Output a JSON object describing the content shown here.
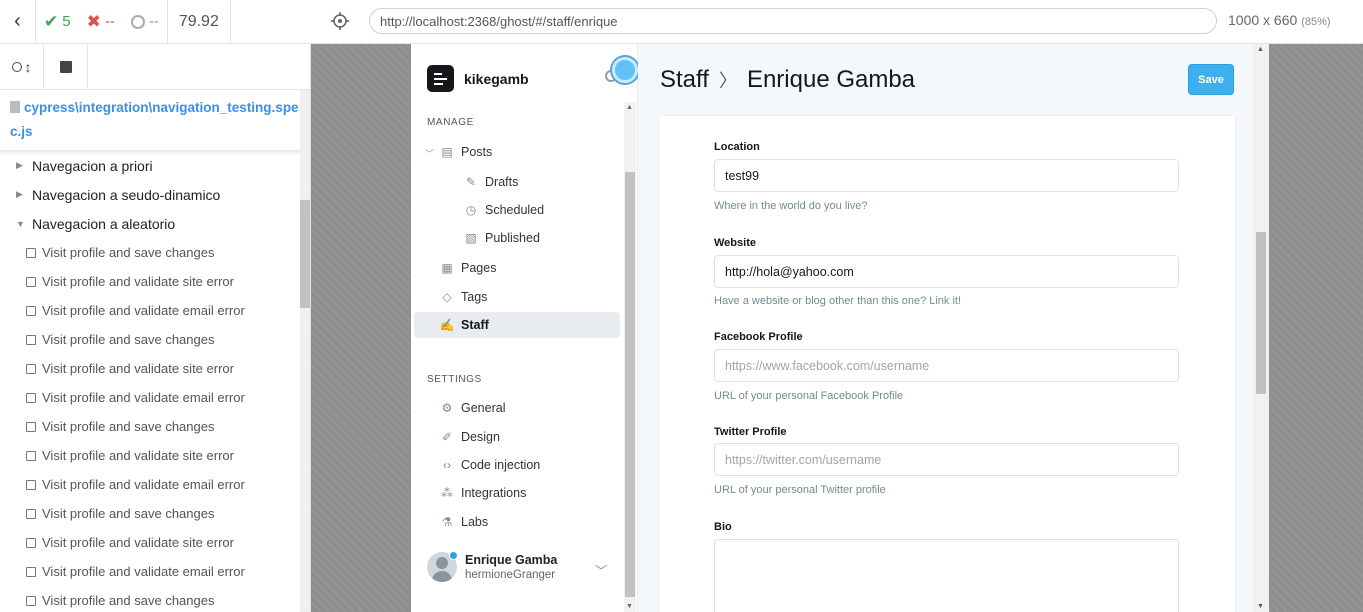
{
  "topbar": {
    "passed": "5",
    "failed": "--",
    "pending": "--",
    "duration": "79.92",
    "url": "http://localhost:2368/ghost/#/staff/enrique",
    "viewport": "1000 x 660",
    "scale": "(85%)"
  },
  "reporter": {
    "spec_file": "cypress\\integration\\navigation_testing.spec.js",
    "suites": [
      {
        "label": "Navegacion a priori",
        "expanded": false
      },
      {
        "label": "Navegacion a seudo-dinamico",
        "expanded": false
      },
      {
        "label": "Navegacion a aleatorio",
        "expanded": true
      }
    ],
    "tests": [
      "Visit profile and save changes",
      "Visit profile and validate site error",
      "Visit profile and validate email error",
      "Visit profile and save changes",
      "Visit profile and validate site error",
      "Visit profile and validate email error",
      "Visit profile and save changes",
      "Visit profile and validate site error",
      "Visit profile and validate email error",
      "Visit profile and save changes",
      "Visit profile and validate site error",
      "Visit profile and validate email error",
      "Visit profile and save changes"
    ]
  },
  "ghost": {
    "blog_name": "kikegamb",
    "manage_heading": "MANAGE",
    "settings_heading": "SETTINGS",
    "nav": {
      "posts": "Posts",
      "drafts": "Drafts",
      "scheduled": "Scheduled",
      "published": "Published",
      "pages": "Pages",
      "tags": "Tags",
      "staff": "Staff"
    },
    "settings_nav": {
      "general": "General",
      "design": "Design",
      "code_injection": "Code injection",
      "integrations": "Integrations",
      "labs": "Labs"
    },
    "user": {
      "name": "Enrique Gamba",
      "handle": "hermioneGranger"
    },
    "header": {
      "breadcrumb": "Staff",
      "title": "Enrique Gamba",
      "save_label": "Save"
    },
    "form": {
      "location": {
        "label": "Location",
        "value": "test99",
        "help": "Where in the world do you live?"
      },
      "website": {
        "label": "Website",
        "value": "http://hola@yahoo.com",
        "help": "Have a website or blog other than this one? Link it!"
      },
      "facebook": {
        "label": "Facebook Profile",
        "placeholder": "https://www.facebook.com/username",
        "help": "URL of your personal Facebook Profile"
      },
      "twitter": {
        "label": "Twitter Profile",
        "placeholder": "https://twitter.com/username",
        "help": "URL of your personal Twitter profile"
      },
      "bio": {
        "label": "Bio"
      }
    }
  }
}
